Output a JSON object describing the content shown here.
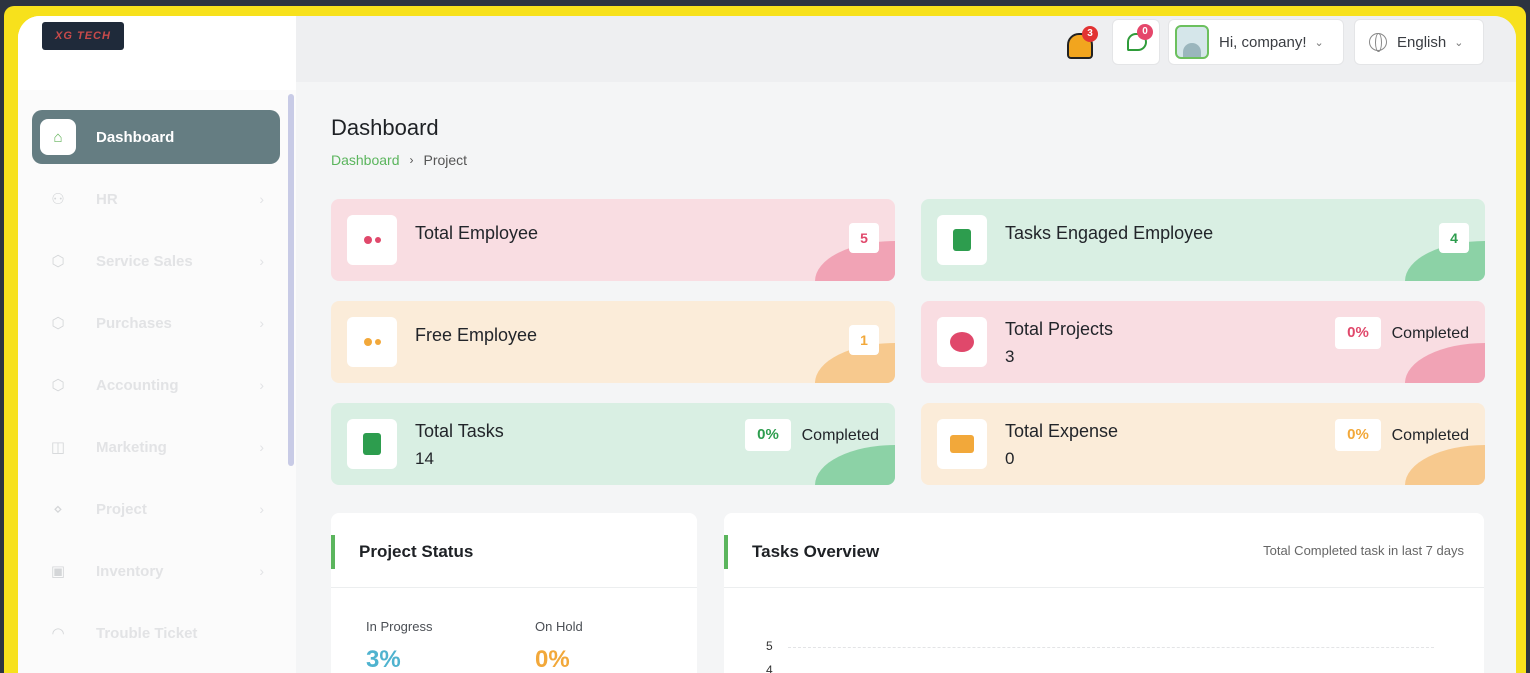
{
  "brand": {
    "logo_text": "XG TECH"
  },
  "sidebar": {
    "items": [
      {
        "label": "Dashboard",
        "icon": "home-icon",
        "active": true
      },
      {
        "label": "HR",
        "icon": "user-icon"
      },
      {
        "label": "Service Sales",
        "icon": "box-icon"
      },
      {
        "label": "Purchases",
        "icon": "box-icon"
      },
      {
        "label": "Accounting",
        "icon": "box-icon"
      },
      {
        "label": "Marketing",
        "icon": "megaphone-icon"
      },
      {
        "label": "Project",
        "icon": "share-nodes-icon"
      },
      {
        "label": "Inventory",
        "icon": "inventory-icon"
      },
      {
        "label": "Trouble Ticket",
        "icon": "headset-icon"
      }
    ]
  },
  "header": {
    "notifications_count": "3",
    "messages_count": "0",
    "user_greeting": "Hi, company!",
    "language": "English"
  },
  "page": {
    "title": "Dashboard",
    "breadcrumb": [
      "Dashboard",
      "Project"
    ]
  },
  "cards": {
    "total_employee": {
      "label": "Total Employee",
      "value": "5"
    },
    "tasks_engaged_employee": {
      "label": "Tasks Engaged Employee",
      "value": "4"
    },
    "free_employee": {
      "label": "Free Employee",
      "value": "1"
    },
    "total_projects": {
      "label": "Total Projects",
      "value": "3",
      "percent": "0%",
      "completed_label": "Completed"
    },
    "total_tasks": {
      "label": "Total Tasks",
      "value": "14",
      "percent": "0%",
      "completed_label": "Completed"
    },
    "total_expense": {
      "label": "Total Expense",
      "value": "0",
      "percent": "0%",
      "completed_label": "Completed"
    }
  },
  "project_status": {
    "title": "Project Status",
    "stats": [
      {
        "label": "In Progress",
        "value": "3%",
        "color": "#4fb3cf"
      },
      {
        "label": "On Hold",
        "value": "0%",
        "color": "#f2a83a"
      }
    ]
  },
  "tasks_overview": {
    "title": "Tasks Overview",
    "subtitle": "Total Completed task in last 7 days",
    "y_ticks": [
      "5",
      "4"
    ]
  },
  "colors": {
    "accent_green": "#5bb55d",
    "sidebar_active": "#657d82",
    "frame_yellow": "#f7e11c"
  }
}
